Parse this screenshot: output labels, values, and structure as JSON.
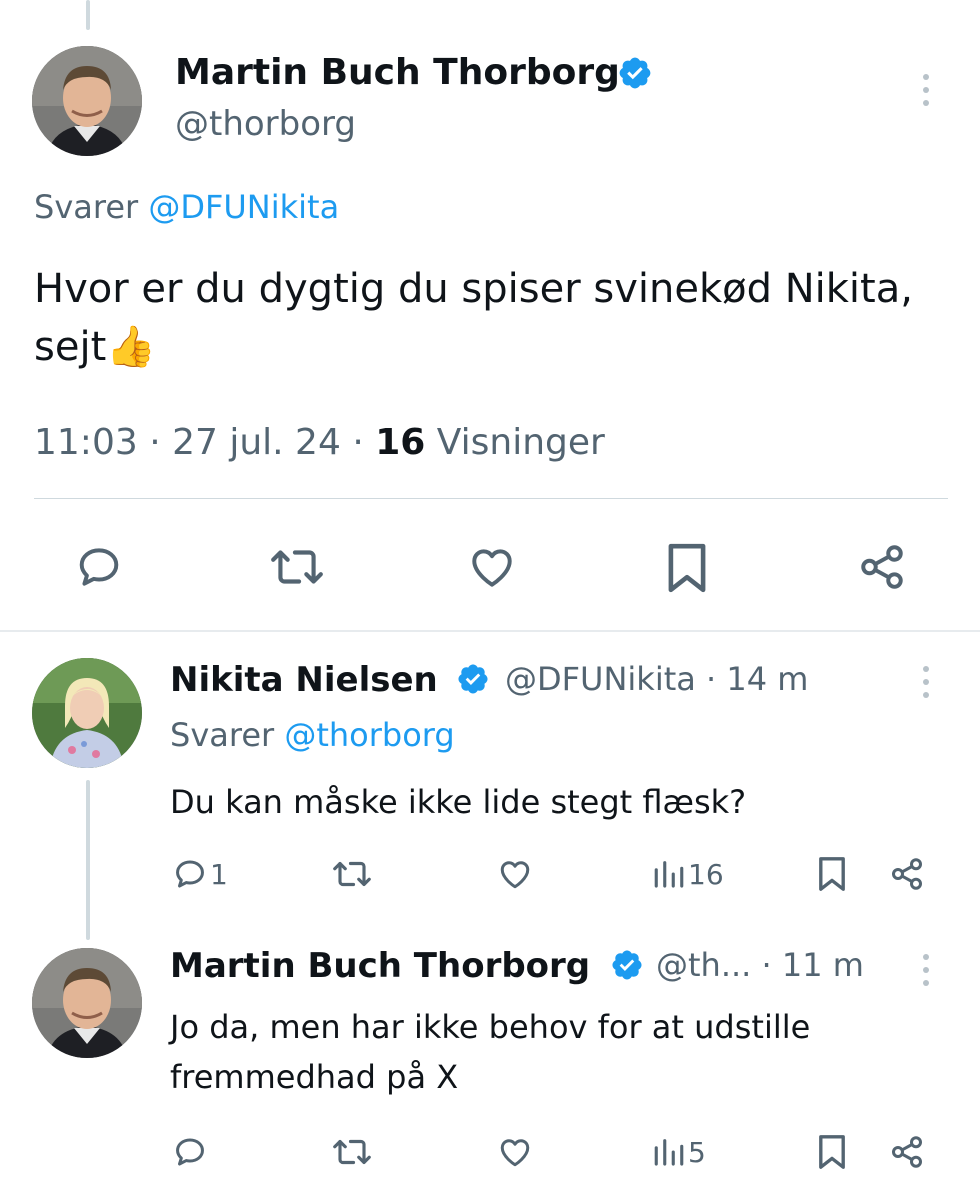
{
  "main_tweet": {
    "name": "Martin Buch Thorborg",
    "handle": "@thorborg",
    "reply_prefix": "Svarer ",
    "reply_mention": "@DFUNikita",
    "text": "Hvor er du dygtig du spiser svinekød Nikita, sejt👍",
    "time": "11:03",
    "date": "27 jul. 24",
    "views_count": "16",
    "views_label": "Visninger",
    "icons": [
      "reply-icon",
      "retweet-icon",
      "like-icon",
      "bookmark-icon",
      "share-icon"
    ]
  },
  "replies": [
    {
      "name": "Nikita Nielsen",
      "handle": "@DFUNikita",
      "time_sep": "·",
      "time": "14 m",
      "reply_prefix": "Svarer ",
      "reply_mention": "@thorborg",
      "text": "Du kan måske ikke lide stegt flæsk?",
      "reply_count": "1",
      "views": "16"
    },
    {
      "name": "Martin Buch Thorborg",
      "handle": "@th...",
      "time_sep": "·",
      "time": "11 m",
      "text": "Jo da, men har ikke behov for at udstille fremmedhad på X",
      "reply_count": "",
      "views": "5"
    }
  ],
  "colors": {
    "text": "#0f1419",
    "muted": "#536471",
    "link": "#1d9bf0",
    "verified": "#1d9bf0",
    "divider": "#cfd9de"
  }
}
